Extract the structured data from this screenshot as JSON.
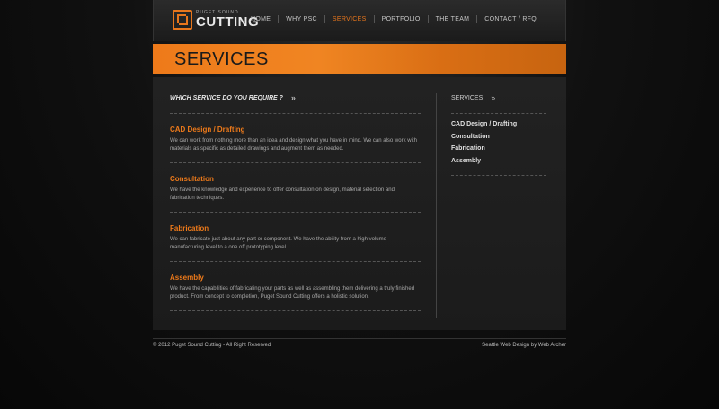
{
  "header": {
    "logo": {
      "small": "PUGET SOUND",
      "big": "CUTTING"
    },
    "nav": [
      {
        "label": "HOME",
        "active": false
      },
      {
        "label": "WHY PSC",
        "active": false
      },
      {
        "label": "SERVICES",
        "active": true
      },
      {
        "label": "PORTFOLIO",
        "active": false
      },
      {
        "label": "THE TEAM",
        "active": false
      },
      {
        "label": "CONTACT / RFQ",
        "active": false
      }
    ]
  },
  "banner": {
    "title": "SERVICES"
  },
  "main": {
    "heading": "WHICH SERVICE DO YOU REQUIRE ?",
    "heading_arrows": "»",
    "services": [
      {
        "title": "CAD Design / Drafting",
        "description": "We can work from nothing more than an idea and design what you have in mind.  We can also work with materials as specific as detailed drawings and augment them as needed."
      },
      {
        "title": "Consultation",
        "description": "We have the knowledge and experience to offer consultation on design, material selection and fabrication techniques."
      },
      {
        "title": "Fabrication",
        "description": "We can fabricate just about any part or component.  We have the ability from a high volume manufacturing level to a one off prototyping level."
      },
      {
        "title": "Assembly",
        "description": "We have the capabilities of fabricating your parts as well as assembling them delivering a truly finished product.  From concept to completion, Puget Sound Cutting offers a holistic solution."
      }
    ]
  },
  "sidebar": {
    "heading": "SERVICES",
    "heading_arrows": "»",
    "items": [
      "CAD Design / Drafting",
      "Consultation",
      "Fabrication",
      "Assembly"
    ]
  },
  "footer": {
    "copyright": "© 2012 Puget Sound Cutting - All Right Reserved",
    "credit": "Seattle Web Design by Web Archer"
  },
  "colors": {
    "accent": "#ee7a1a",
    "background": "#0a0a0a",
    "panel": "#1e1e1e"
  }
}
